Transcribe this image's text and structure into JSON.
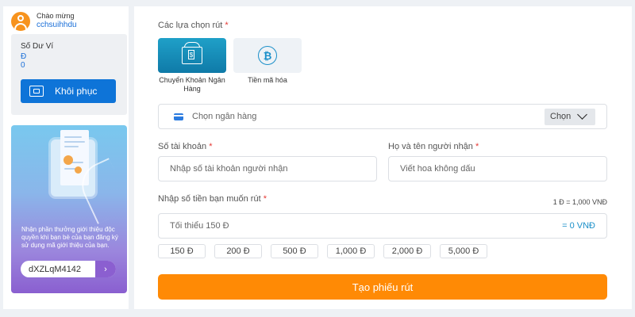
{
  "user": {
    "greeting": "Chào mừng",
    "username": "cchsuihhdu"
  },
  "wallet": {
    "label": "Số Dư Ví",
    "currency": "Đ",
    "amount": "0",
    "restore_label": "Khôi phục"
  },
  "promo": {
    "text": "Nhận phần thưởng giới thiệu độc quyền khi bạn bè của bạn đăng ký sử dụng mã giới thiệu của bạn.",
    "code": "dXZLqM4142",
    "arrow": "›"
  },
  "withdraw": {
    "options_label": "Các lựa chọn rút",
    "required_mark": "*",
    "methods": [
      {
        "label": "Chuyển Khoản Ngân Hàng",
        "icon": "bank-icon",
        "active": true
      },
      {
        "label": "Tiền mã hóa",
        "icon": "bitcoin-icon",
        "active": false
      }
    ],
    "bank_select": {
      "placeholder": "Chọn ngân hàng",
      "button": "Chọn"
    },
    "account_number": {
      "label": "Số tài khoản",
      "placeholder": "Nhập số tài khoản người nhận"
    },
    "recipient_name": {
      "label": "Họ và tên người nhận",
      "placeholder": "Viết hoa không dấu"
    },
    "amount": {
      "label": "Nhập số tiền bạn muốn rút",
      "rate": "1 Đ = 1,000 VNĐ",
      "placeholder": "Tối thiểu 150 Đ",
      "converted": "= 0 VNĐ"
    },
    "quick_amounts": [
      "150 Đ",
      "200 Đ",
      "500 Đ",
      "1,000 Đ",
      "2,000 Đ",
      "5,000 Đ"
    ],
    "submit_label": "Tạo phiếu rút"
  },
  "colors": {
    "accent": "#ff8a05",
    "primary": "#0e74d8",
    "active_method": "#1a8fc9",
    "required": "#e53935"
  }
}
